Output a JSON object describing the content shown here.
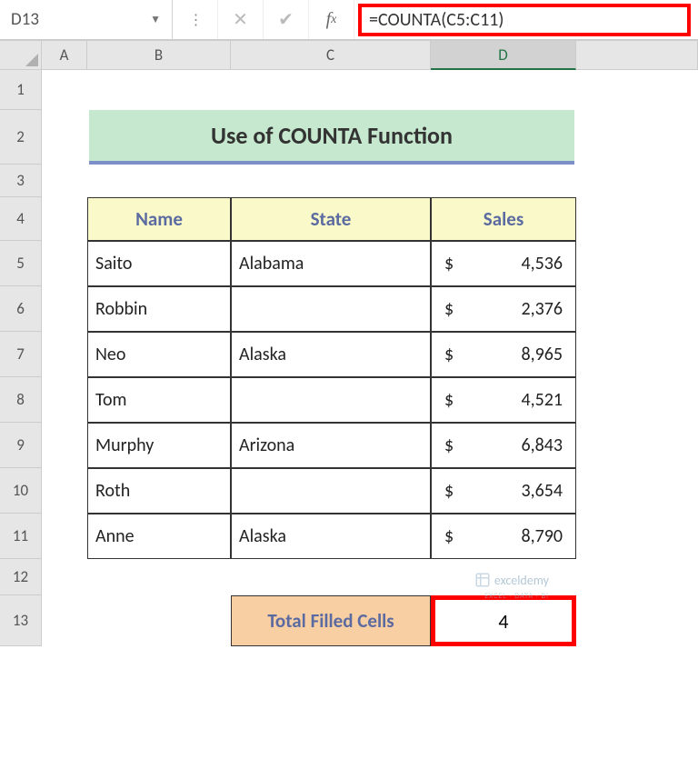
{
  "formula_bar": {
    "cell_ref": "D13",
    "formula": "=COUNTA(C5:C11)"
  },
  "columns": [
    "A",
    "B",
    "C",
    "D"
  ],
  "rows": [
    "1",
    "2",
    "3",
    "4",
    "5",
    "6",
    "7",
    "8",
    "9",
    "10",
    "11",
    "12",
    "13"
  ],
  "title": "Use of COUNTA Function",
  "table": {
    "headers": {
      "name": "Name",
      "state": "State",
      "sales": "Sales"
    },
    "rows": [
      {
        "name": "Saito",
        "state": "Alabama",
        "currency": "$",
        "sales": "4,536"
      },
      {
        "name": "Robbin",
        "state": "",
        "currency": "$",
        "sales": "2,376"
      },
      {
        "name": "Neo",
        "state": "Alaska",
        "currency": "$",
        "sales": "8,965"
      },
      {
        "name": "Tom",
        "state": "",
        "currency": "$",
        "sales": "4,521"
      },
      {
        "name": "Murphy",
        "state": "Arizona",
        "currency": "$",
        "sales": "6,843"
      },
      {
        "name": "Roth",
        "state": "",
        "currency": "$",
        "sales": "3,654"
      },
      {
        "name": "Anne",
        "state": "Alaska",
        "currency": "$",
        "sales": "8,790"
      }
    ]
  },
  "summary": {
    "label": "Total Filled Cells",
    "value": "4"
  },
  "watermark": {
    "text": "exceldemy",
    "sub": "EXCEL · DATA · BI"
  }
}
